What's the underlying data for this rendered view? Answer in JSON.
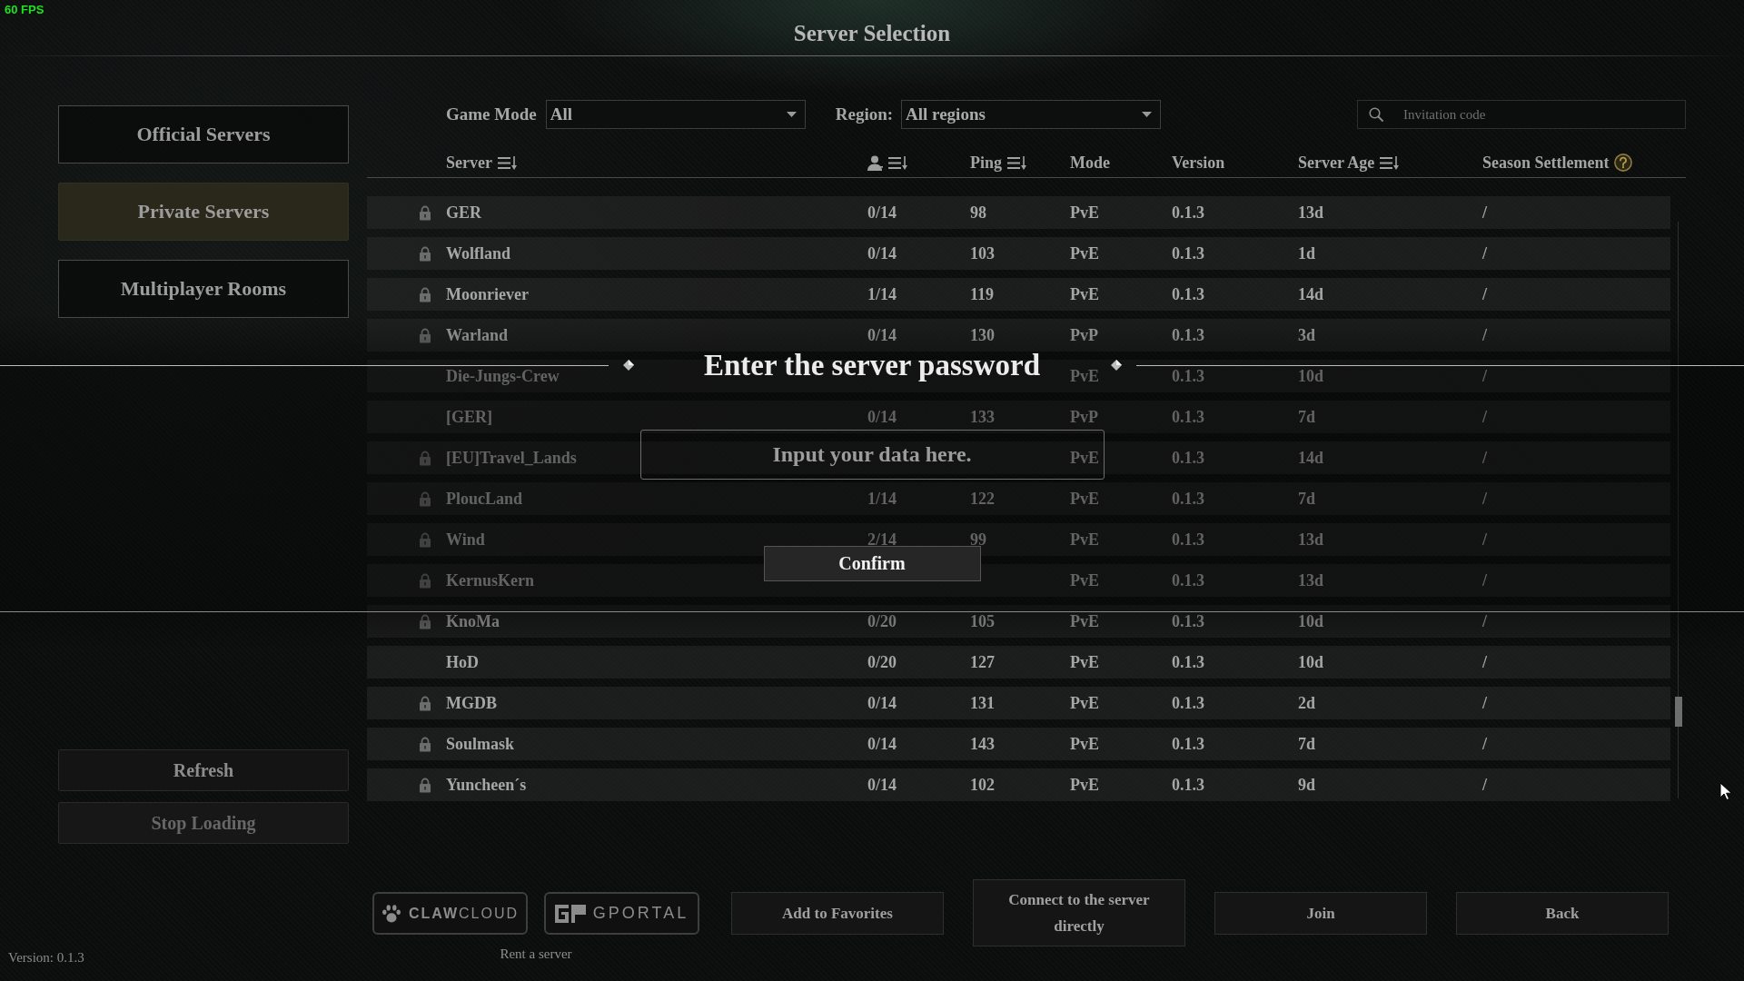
{
  "fps_counter": "60 FPS",
  "title": "Server Selection",
  "sidebar": {
    "tabs": [
      {
        "label": "Official Servers",
        "selected": false
      },
      {
        "label": "Private Servers",
        "selected": true
      },
      {
        "label": "Multiplayer Rooms",
        "selected": false
      }
    ],
    "actions": [
      {
        "label": "Refresh",
        "disabled": false
      },
      {
        "label": "Stop Loading",
        "disabled": true
      }
    ],
    "version": "Version: 0.1.3"
  },
  "filters": {
    "game_mode": {
      "label": "Game Mode",
      "value": "All"
    },
    "region": {
      "label": "Region:",
      "value": "All regions"
    },
    "search": {
      "placeholder": "Invitation code"
    }
  },
  "table": {
    "columns": [
      {
        "kind": "text",
        "label": "Server",
        "sortable": true,
        "help": false
      },
      {
        "kind": "players",
        "sortable": true,
        "help": false
      },
      {
        "kind": "text",
        "label": "Ping",
        "sortable": true,
        "help": false
      },
      {
        "kind": "text",
        "label": "Mode",
        "sortable": false,
        "help": false
      },
      {
        "kind": "text",
        "label": "Version",
        "sortable": false,
        "help": false
      },
      {
        "kind": "text",
        "label": "Server Age",
        "sortable": true,
        "help": false
      },
      {
        "kind": "text",
        "label": "Season Settlement",
        "sortable": false,
        "help": true
      }
    ],
    "rows": [
      {
        "locked": true,
        "name": "GER",
        "players": "0/14",
        "ping": "98",
        "mode": "PvE",
        "version": "0.1.3",
        "age": "13d",
        "season": "/"
      },
      {
        "locked": true,
        "name": "Wolfland",
        "players": "0/14",
        "ping": "103",
        "mode": "PvE",
        "version": "0.1.3",
        "age": "1d",
        "season": "/"
      },
      {
        "locked": true,
        "name": "Moonriever",
        "players": "1/14",
        "ping": "119",
        "mode": "PvE",
        "version": "0.1.3",
        "age": "14d",
        "season": "/"
      },
      {
        "locked": true,
        "name": "Warland",
        "players": "0/14",
        "ping": "130",
        "mode": "PvP",
        "version": "0.1.3",
        "age": "3d",
        "season": "/"
      },
      {
        "locked": false,
        "name": "Die-Jungs-Crew",
        "mode": "PvE",
        "version": "0.1.3",
        "age": "10d",
        "season": "/"
      },
      {
        "locked": false,
        "name": "[GER]",
        "players": "0/14",
        "ping": "133",
        "mode": "PvP",
        "version": "0.1.3",
        "age": "7d",
        "season": "/"
      },
      {
        "locked": true,
        "name": "[EU]Travel_Lands",
        "mode": "PvE",
        "version": "0.1.3",
        "age": "14d",
        "season": "/"
      },
      {
        "locked": true,
        "name": "PloucLand",
        "players": "1/14",
        "ping": "122",
        "mode": "PvE",
        "version": "0.1.3",
        "age": "7d",
        "season": "/"
      },
      {
        "locked": true,
        "name": "Wind",
        "players": "2/14",
        "ping": "99",
        "mode": "PvE",
        "version": "0.1.3",
        "age": "13d",
        "season": "/"
      },
      {
        "locked": true,
        "name": "KernusKern",
        "mode": "PvE",
        "version": "0.1.3",
        "age": "13d",
        "season": "/"
      },
      {
        "locked": true,
        "name": "KnoMa",
        "players": "0/20",
        "ping": "105",
        "mode": "PvE",
        "version": "0.1.3",
        "age": "10d",
        "season": "/"
      },
      {
        "locked": false,
        "name": "HoD",
        "players": "0/20",
        "ping": "127",
        "mode": "PvE",
        "version": "0.1.3",
        "age": "10d",
        "season": "/"
      },
      {
        "locked": true,
        "name": "MGDB",
        "players": "0/14",
        "ping": "131",
        "mode": "PvE",
        "version": "0.1.3",
        "age": "2d",
        "season": "/"
      },
      {
        "locked": true,
        "name": "Soulmask",
        "players": "0/14",
        "ping": "143",
        "mode": "PvE",
        "version": "0.1.3",
        "age": "7d",
        "season": "/"
      },
      {
        "locked": true,
        "name": "Yuncheen´s",
        "players": "0/14",
        "ping": "102",
        "mode": "PvE",
        "version": "0.1.3",
        "age": "9d",
        "season": "/"
      }
    ]
  },
  "footer": {
    "partners": [
      {
        "kind": "clawcloud",
        "label": "**CLAW**CLOUD"
      },
      {
        "kind": "gportal",
        "label": "GPORTAL"
      }
    ],
    "partners_caption": "Rent a server",
    "buttons": [
      "Add to Favorites",
      "Connect to the server directly",
      "Join",
      "Back"
    ]
  },
  "dialog": {
    "title": "Enter the server password",
    "input": {
      "placeholder": "Input your data here."
    },
    "button": "Confirm"
  }
}
